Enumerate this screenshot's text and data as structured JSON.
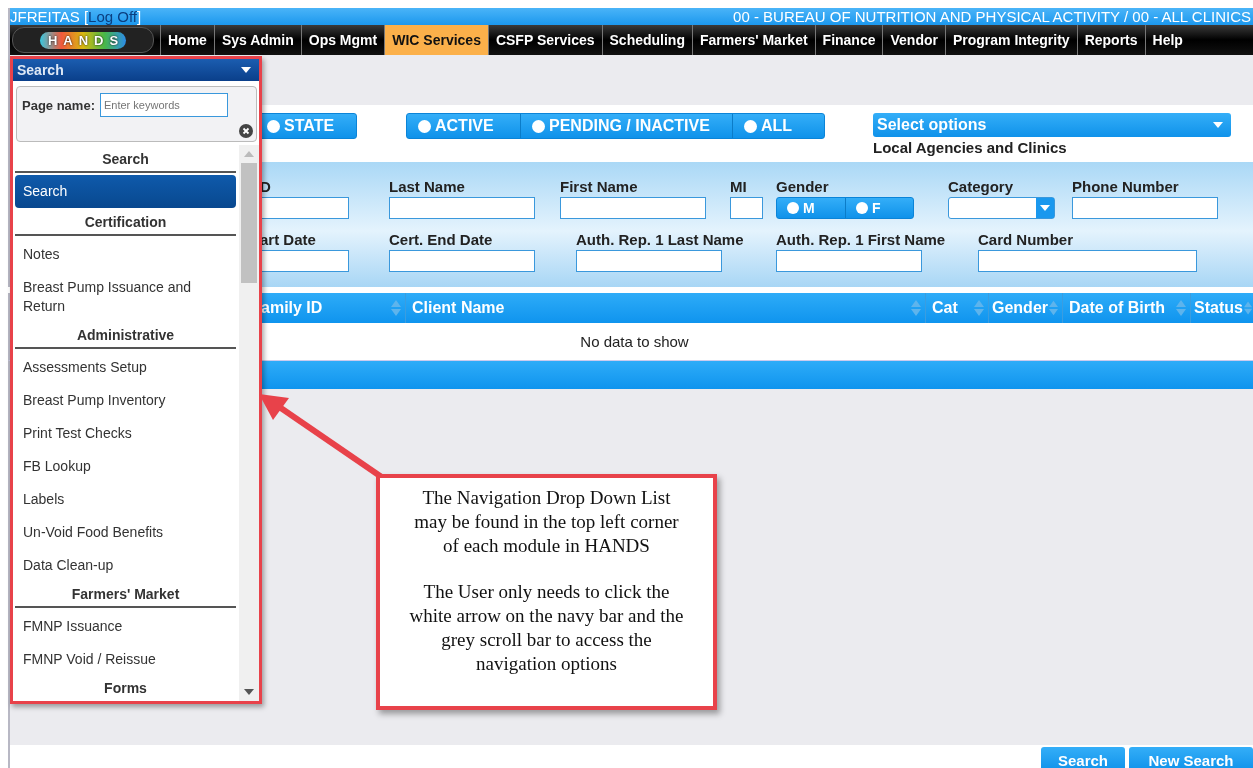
{
  "header": {
    "user": "JFREITAS [",
    "logoff": "Log Off",
    "close_bracket": "]",
    "agency": "00 - BUREAU OF NUTRITION AND PHYSICAL ACTIVITY / 00 - ALL CLINICS"
  },
  "logo": "HANDS",
  "nav": [
    {
      "label": "Home",
      "selected": false
    },
    {
      "label": "Sys Admin",
      "selected": false
    },
    {
      "label": "Ops Mgmt",
      "selected": false
    },
    {
      "label": "WIC Services",
      "selected": true
    },
    {
      "label": "CSFP Services",
      "selected": false
    },
    {
      "label": "Scheduling",
      "selected": false
    },
    {
      "label": "Farmers' Market",
      "selected": false
    },
    {
      "label": "Finance",
      "selected": false
    },
    {
      "label": "Vendor",
      "selected": false
    },
    {
      "label": "Program Integrity",
      "selected": false
    },
    {
      "label": "Reports",
      "selected": false
    },
    {
      "label": "Help",
      "selected": false
    }
  ],
  "scope_toggle": [
    {
      "label": "STATE",
      "selected": false
    }
  ],
  "status_toggle": [
    {
      "label": "ACTIVE",
      "selected": false
    },
    {
      "label": "PENDING / INACTIVE",
      "selected": false
    },
    {
      "label": "ALL",
      "selected": false
    }
  ],
  "agencies": {
    "placeholder": "Select options",
    "label": "Local Agencies and Clinics"
  },
  "form_rows": [
    [
      {
        "kind": "text",
        "label": "D"
      },
      {
        "kind": "text",
        "label": "Last Name"
      },
      {
        "kind": "text",
        "label": "First Name"
      },
      {
        "kind": "text",
        "label": "MI"
      },
      {
        "kind": "radio",
        "label": "Gender",
        "options": [
          {
            "label": "M",
            "selected": false
          },
          {
            "label": "F",
            "selected": false
          }
        ]
      },
      {
        "kind": "select",
        "label": "Category"
      },
      {
        "kind": "text",
        "label": "Phone Number"
      }
    ],
    [
      {
        "kind": "text",
        "label": "art Date"
      },
      {
        "kind": "text",
        "label": "Cert. End Date"
      },
      {
        "kind": "text",
        "label": "Auth. Rep. 1 Last Name"
      },
      {
        "kind": "text",
        "label": "Auth. Rep. 1 First Name"
      },
      {
        "kind": "text",
        "label": "Card Number"
      }
    ]
  ],
  "table": {
    "columns": [
      "amily ID",
      "Client Name",
      "Cat",
      "Gender",
      "Date of Birth",
      "Status"
    ],
    "empty": "No data to show"
  },
  "buttons": [
    "Search",
    "New Search"
  ],
  "dropdown": {
    "title": "Search",
    "search_label": "Page name:",
    "search_placeholder": "Enter keywords",
    "groups": [
      {
        "heading": "Search",
        "items": [
          {
            "label": "Search",
            "selected": true
          }
        ]
      },
      {
        "heading": "Certification",
        "items": [
          {
            "label": "Notes",
            "selected": false
          },
          {
            "label": "Breast Pump Issuance and Return",
            "selected": false
          }
        ]
      },
      {
        "heading": "Administrative",
        "items": [
          {
            "label": "Assessments Setup",
            "selected": false
          },
          {
            "label": "Breast Pump Inventory",
            "selected": false
          },
          {
            "label": "Print Test Checks",
            "selected": false
          },
          {
            "label": "FB Lookup",
            "selected": false
          },
          {
            "label": "Labels",
            "selected": false
          },
          {
            "label": "Un-Void Food Benefits",
            "selected": false
          },
          {
            "label": "Data Clean-up",
            "selected": false
          }
        ]
      },
      {
        "heading": "Farmers' Market",
        "items": [
          {
            "label": "FMNP Issuance",
            "selected": false
          },
          {
            "label": "FMNP Void / Reissue",
            "selected": false
          }
        ]
      },
      {
        "heading": "Forms"
      }
    ]
  },
  "callout": [
    "The Navigation Drop Down List may be found in the top left corner of each module in HANDS",
    "The User only needs to click the white arrow on the navy bar and the grey scroll bar to access the navigation options"
  ]
}
